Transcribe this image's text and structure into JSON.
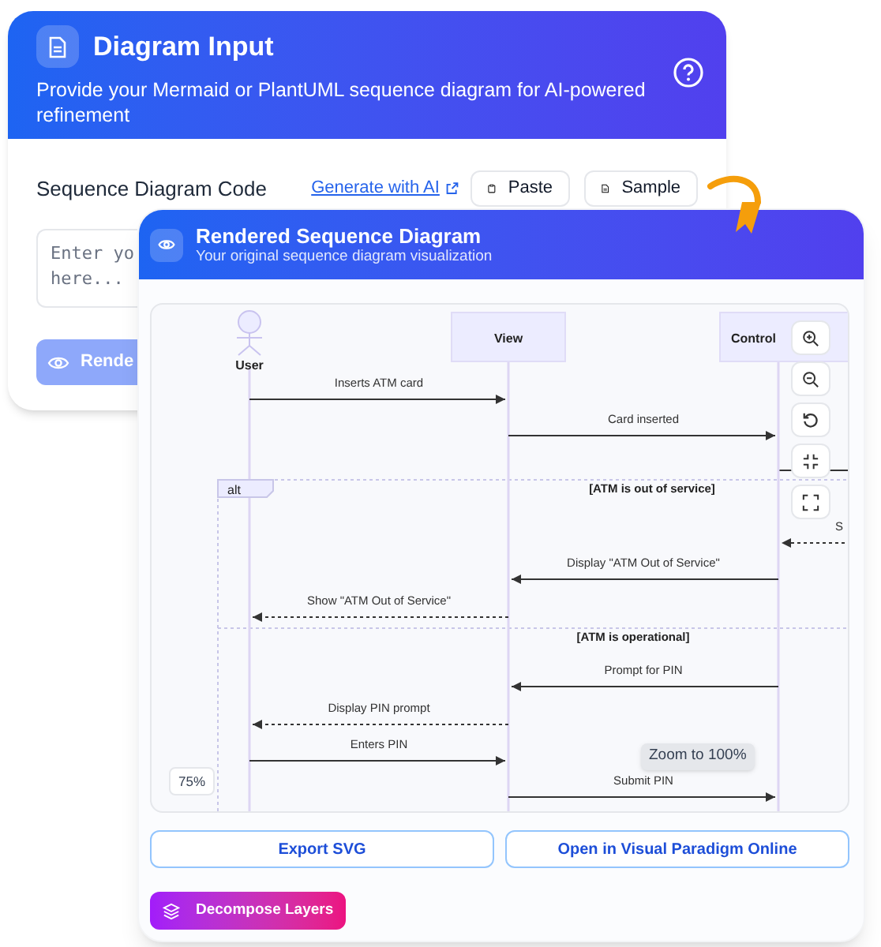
{
  "input_panel": {
    "title": "Diagram Input",
    "subtitle": "Provide your Mermaid or PlantUML sequence diagram for AI-powered refinement",
    "code_label": "Sequence Diagram Code",
    "generate_link": "Generate with AI",
    "paste_button": "Paste",
    "sample_button": "Sample",
    "code_placeholder": "Enter yo here...",
    "render_button": "Rende"
  },
  "preview_panel": {
    "title": "Rendered Sequence Diagram",
    "subtitle": "Your original sequence diagram visualization",
    "diagram": {
      "participants": [
        {
          "label": "User",
          "kind": "actor"
        },
        {
          "label": "View",
          "kind": "box"
        },
        {
          "label": "Control",
          "kind": "box"
        }
      ],
      "fragment": {
        "label": "alt",
        "conditions": [
          "[ATM is out of service]",
          "[ATM is operational]"
        ]
      },
      "messages": [
        {
          "label": "Inserts ATM card",
          "kind": "call"
        },
        {
          "label": "Card inserted",
          "kind": "call"
        },
        {
          "label": "S",
          "kind": "reply"
        },
        {
          "label": "Display \"ATM Out of Service\"",
          "kind": "call"
        },
        {
          "label": "Show \"ATM Out of Service\"",
          "kind": "reply"
        },
        {
          "label": "Prompt for PIN",
          "kind": "call"
        },
        {
          "label": "Display PIN prompt",
          "kind": "reply"
        },
        {
          "label": "Enters PIN",
          "kind": "call"
        },
        {
          "label": "Submit PIN",
          "kind": "call"
        }
      ]
    },
    "zoom_level": "75%",
    "tooltip": "Zoom to 100%",
    "actions": [
      "Export SVG",
      "Open in Visual Paradigm Online"
    ],
    "decompose_button": "Decompose Layers"
  }
}
